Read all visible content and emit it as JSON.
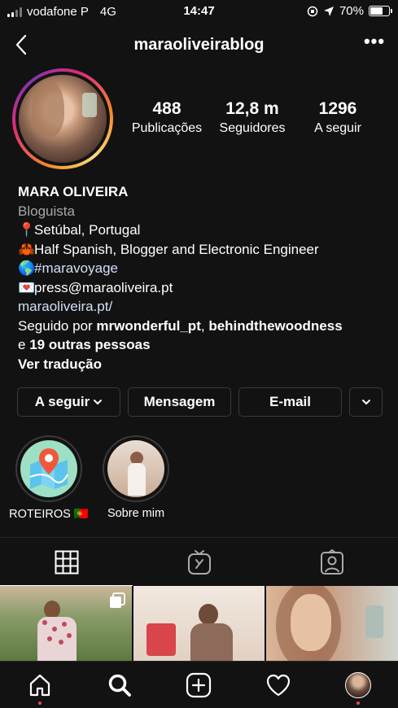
{
  "status_bar": {
    "carrier": "vodafone P",
    "network": "4G",
    "time": "14:47",
    "battery": "70%",
    "battery_level": 0.7
  },
  "header": {
    "username": "maraoliveirablog",
    "back_icon": "chevron-left-icon",
    "more_icon": "more-horizontal-icon",
    "more_glyph": "•••"
  },
  "stats": [
    {
      "value": "488",
      "label": "Publicações"
    },
    {
      "value": "12,8 m",
      "label": "Seguidores"
    },
    {
      "value": "1296",
      "label": "A seguir"
    }
  ],
  "bio": {
    "name": "MARA OLIVEIRA",
    "category": "Bloguista",
    "location_emoji": "📍",
    "location": "Setúbal, Portugal",
    "crab_emoji": "🦀",
    "about": "Half Spanish, Blogger and Electronic Engineer",
    "globe_emoji": "🌎",
    "hashtag": "#maravoyage",
    "mail_emoji": "💌",
    "email": "press@maraoliveira.pt",
    "website": "maraoliveira.pt/",
    "followed_by_prefix": "Seguido por ",
    "followed_by_user1": "mrwonderful_pt",
    "followed_by_sep": ", ",
    "followed_by_user2": "behindthewoodness",
    "followed_by_and": "e ",
    "followed_by_others": "19 outras pessoas",
    "translate": "Ver tradução"
  },
  "buttons": {
    "following": "A seguir",
    "following_chevron": "⌄",
    "message": "Mensagem",
    "email": "E-mail"
  },
  "highlights": [
    {
      "label": "ROTEIROS 🇵🇹",
      "icon": "map-pin-icon"
    },
    {
      "label": "Sobre mim"
    }
  ],
  "tabs": [
    {
      "name": "grid",
      "icon": "grid-icon",
      "active": true
    },
    {
      "name": "igtv",
      "icon": "igtv-icon",
      "active": false
    },
    {
      "name": "tagged",
      "icon": "tagged-user-icon",
      "active": false
    }
  ],
  "bottom_nav": [
    {
      "name": "home",
      "icon": "home-icon",
      "notification_dot": true
    },
    {
      "name": "search",
      "icon": "search-icon",
      "active": true
    },
    {
      "name": "new-post",
      "icon": "plus-square-icon"
    },
    {
      "name": "activity",
      "icon": "heart-icon"
    },
    {
      "name": "profile",
      "icon": "profile-avatar",
      "notification_dot": true
    }
  ],
  "colors": {
    "background": "#121212",
    "link": "#d0e0f5",
    "secondary_text": "#a8a8a8",
    "notification": "#ed4956"
  }
}
